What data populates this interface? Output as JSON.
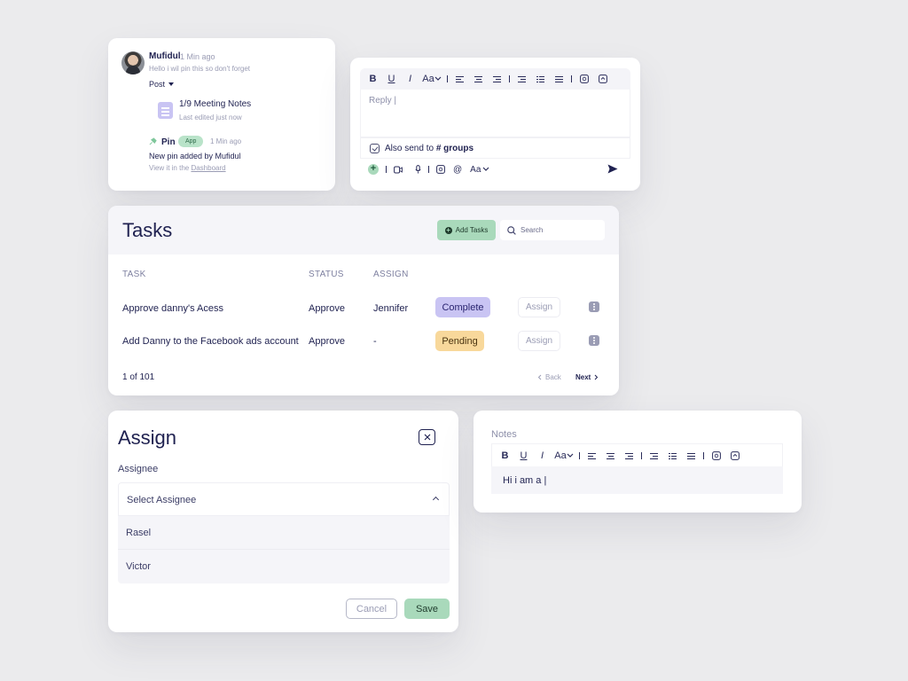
{
  "comment": {
    "author": "Mufidul",
    "time": "1 Min ago",
    "message": "Hello i wil pin this so don't forget",
    "post_label": "Post",
    "note_title": "1/9 Meeting Notes",
    "note_subtitle": "Last edited just now",
    "pin_label": "Pin",
    "app_badge": "App",
    "pin_time": "1 Min ago",
    "pin_message": "New pin added by Mufidul",
    "view_prefix": "View it in the ",
    "view_link": "Dashboard"
  },
  "reply_editor": {
    "placeholder": "Reply |",
    "also_send_prefix": "Also send to ",
    "also_send_target": "# groups",
    "toolbar": {
      "bold": "B",
      "underline": "U",
      "italic": "I",
      "font_size": "Aa"
    },
    "bottom_toolbar": {
      "add": "+",
      "mention": "@",
      "font_size": "Aa"
    }
  },
  "tasks": {
    "title": "Tasks",
    "add_button": "Add Tasks",
    "search_placeholder": "Search",
    "columns": [
      "TASK",
      "STATUS",
      "ASSIGN"
    ],
    "rows": [
      {
        "task": "Approve danny's Acess",
        "status": "Approve",
        "assign": "Jennifer",
        "state": "Complete",
        "assign_button": "Assign"
      },
      {
        "task": "Add Danny to the Facebook ads account",
        "status": "Approve",
        "assign": "-",
        "state": "Pending",
        "assign_button": "Assign"
      }
    ],
    "pager": "1 of 101",
    "back": "Back",
    "next": "Next"
  },
  "assign_modal": {
    "title": "Assign",
    "label": "Assignee",
    "select_placeholder": "Select Assignee",
    "options": [
      "Rasel",
      "Victor"
    ],
    "cancel": "Cancel",
    "save": "Save"
  },
  "notes": {
    "label": "Notes",
    "content": "Hi i am a |",
    "toolbar": {
      "bold": "B",
      "underline": "U",
      "italic": "I",
      "font_size": "Aa"
    }
  },
  "colors": {
    "background": "#ebebed",
    "accent_green": "#a9d9bb",
    "accent_purple": "#c9c4f3",
    "accent_yellow": "#f8d89b",
    "text_dark": "#1f2150"
  },
  "icons": [
    "avatar",
    "note-icon",
    "pin-icon",
    "bold-icon",
    "underline-icon",
    "italic-icon",
    "align-left-icon",
    "align-center-icon",
    "align-right-icon",
    "indent-icon",
    "list-icon",
    "justify-icon",
    "emoji-icon",
    "attachment-icon",
    "video-icon",
    "mic-icon",
    "at-icon",
    "send-icon",
    "search-icon",
    "plus-icon",
    "more-icon",
    "close-icon",
    "chevron-up-icon",
    "chevron-left-icon",
    "chevron-right-icon"
  ]
}
